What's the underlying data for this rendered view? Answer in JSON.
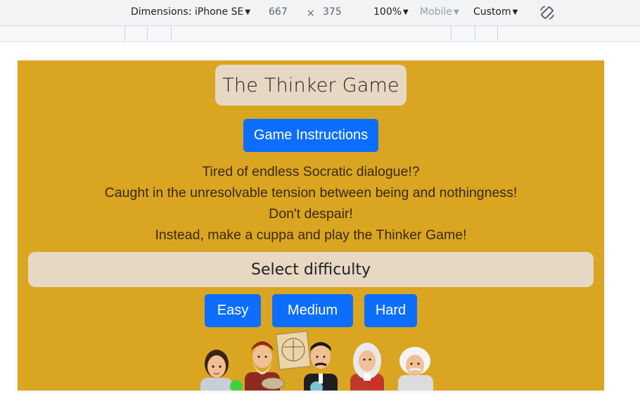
{
  "devtools": {
    "dimensions_label": "Dimensions: iPhone SE",
    "width": "667",
    "times": "×",
    "height": "375",
    "zoom": "100%",
    "mode": "Mobile",
    "throttle": "Custom",
    "rotate_icon": "rotate-icon"
  },
  "page": {
    "title": "The Thinker Game",
    "instructions_button": "Game Instructions",
    "intro_lines": [
      "Tired of endless Socratic dialogue!?",
      "Caught in the unresolvable tension between being and nothingness!",
      "Don't despair!",
      "Instead, make a cuppa and play the Thinker Game!"
    ],
    "difficulty_heading": "Select difficulty",
    "difficulty_buttons": {
      "easy": "Easy",
      "medium": "Medium",
      "hard": "Hard"
    },
    "illustration": "thinkers-illustration"
  },
  "colors": {
    "background": "#daa520",
    "panel": "#e6d8c3",
    "button": "#0d6efd"
  }
}
